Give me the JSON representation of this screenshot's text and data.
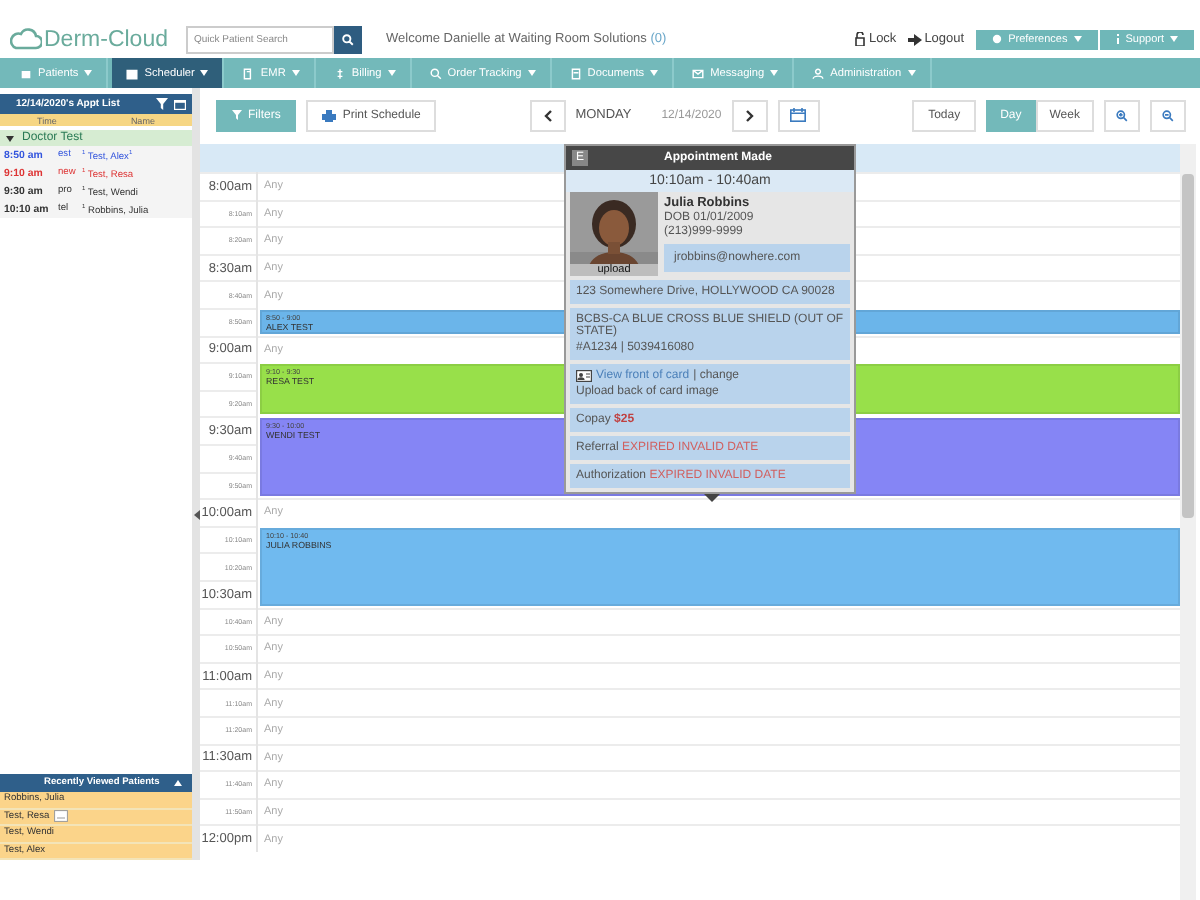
{
  "header": {
    "logo": "Derm-Cloud",
    "search": {
      "placeholder": "Quick Patient Search"
    },
    "welcome": "Welcome Danielle at Waiting Room Solutions",
    "welcome_count": "(0)",
    "lock": "Lock",
    "logout": "Logout",
    "menus": [
      {
        "label": "Preferences"
      },
      {
        "label": "Support"
      }
    ]
  },
  "nav": [
    {
      "label": "Patients",
      "selected": false
    },
    {
      "label": "Scheduler",
      "selected": true
    },
    {
      "label": "EMR",
      "selected": false
    },
    {
      "label": "Billing",
      "selected": false
    },
    {
      "label": "Order Tracking",
      "selected": false
    },
    {
      "label": "Documents",
      "selected": false
    },
    {
      "label": "Messaging",
      "selected": false
    },
    {
      "label": "Administration",
      "selected": false
    }
  ],
  "sidebar": {
    "title": "12/14/2020's Appt List",
    "columns": [
      "Time",
      "Name"
    ],
    "group": {
      "label": "Doctor Test",
      "expanded": true
    },
    "appointments": [
      {
        "time": "8:50 am",
        "type": "est",
        "name": "$^{1}$ Test, Alex$^{1}$",
        "color": "#3355dd"
      },
      {
        "time": "9:10 am",
        "type": "new",
        "name": "$^{1}$ Test, Resa",
        "color": "#dd3333"
      },
      {
        "time": "9:30 am",
        "type": "pro",
        "name": "$^{1}$ Test, Wendi",
        "color": "#333333"
      },
      {
        "time": "10:10 am",
        "type": "tel",
        "name": "$^{1}$ Robbins, Julia",
        "color": "#333333"
      }
    ]
  },
  "recent": {
    "title": "Recently Viewed Patients",
    "items": [
      {
        "name": "Robbins, Julia",
        "note": false
      },
      {
        "name": "Test, Resa",
        "note": true
      },
      {
        "name": "Test, Wendi",
        "note": false
      },
      {
        "name": "Test, Alex",
        "note": false
      }
    ]
  },
  "toolbar": {
    "filters": "Filters",
    "print": "Print Schedule",
    "day_name": "MONDAY",
    "date": "12/14/2020",
    "today": "Today",
    "views": [
      {
        "label": "Day",
        "selected": true
      },
      {
        "label": "Week",
        "selected": false
      }
    ]
  },
  "calendar": {
    "rows": [
      {
        "kind": "open",
        "text": "Any",
        "times": [
          {
            "label": "8:00am",
            "major": true
          }
        ]
      },
      {
        "kind": "open",
        "text": "Any",
        "times": [
          {
            "label": "8:10am",
            "major": false
          }
        ]
      },
      {
        "kind": "open",
        "text": "Any",
        "times": [
          {
            "label": "8:20am",
            "major": false
          }
        ]
      },
      {
        "kind": "open",
        "text": "Any",
        "times": [
          {
            "label": "8:30am",
            "major": true
          }
        ]
      },
      {
        "kind": "open",
        "text": "Any",
        "times": [
          {
            "label": "8:40am",
            "major": false
          }
        ]
      },
      {
        "kind": "appointment",
        "range": "8:50 - 9:00",
        "patient": "ALEX TEST",
        "color": "#6bb5ea",
        "times": [
          {
            "label": "8:50am",
            "major": false
          }
        ]
      },
      {
        "kind": "open",
        "text": "Any",
        "times": [
          {
            "label": "9:00am",
            "major": true
          }
        ]
      },
      {
        "kind": "appointment",
        "range": "9:10 - 9:30",
        "patient": "RESA TEST",
        "color": "#98e04a",
        "times": [
          {
            "label": "9:10am",
            "major": false
          },
          {
            "label": "9:20am",
            "major": false
          }
        ]
      },
      {
        "kind": "appointment",
        "range": "9:30 - 10:00",
        "patient": "WENDI TEST",
        "color": "#8585f5",
        "times": [
          {
            "label": "9:30am",
            "major": true
          },
          {
            "label": "9:40am",
            "major": false
          },
          {
            "label": "9:50am",
            "major": false
          }
        ]
      },
      {
        "kind": "open",
        "text": "Any",
        "times": [
          {
            "label": "10:00am",
            "major": true
          }
        ]
      },
      {
        "kind": "appointment",
        "range": "10:10 - 10:40",
        "patient": "JULIA ROBBINS",
        "color": "#70baef",
        "times": [
          {
            "label": "10:10am",
            "major": false
          },
          {
            "label": "10:20am",
            "major": false
          },
          {
            "label": "10:30am",
            "major": true
          }
        ]
      },
      {
        "kind": "open",
        "text": "Any",
        "times": [
          {
            "label": "10:40am",
            "major": false
          }
        ]
      },
      {
        "kind": "open",
        "text": "Any",
        "times": [
          {
            "label": "10:50am",
            "major": false
          }
        ]
      },
      {
        "kind": "open",
        "text": "Any",
        "times": [
          {
            "label": "11:00am",
            "major": true
          }
        ]
      },
      {
        "kind": "open",
        "text": "Any",
        "times": [
          {
            "label": "11:10am",
            "major": false
          }
        ]
      },
      {
        "kind": "open",
        "text": "Any",
        "times": [
          {
            "label": "11:20am",
            "major": false
          }
        ]
      },
      {
        "kind": "open",
        "text": "Any",
        "times": [
          {
            "label": "11:30am",
            "major": true
          }
        ]
      },
      {
        "kind": "open",
        "text": "Any",
        "times": [
          {
            "label": "11:40am",
            "major": false
          }
        ]
      },
      {
        "kind": "open",
        "text": "Any",
        "times": [
          {
            "label": "11:50am",
            "major": false
          }
        ]
      },
      {
        "kind": "open",
        "text": "Any",
        "times": [
          {
            "label": "12:00pm",
            "major": true
          }
        ]
      }
    ]
  },
  "popup": {
    "badge": "E",
    "status": "Appointment Made",
    "time": "10:10am - 10:40am",
    "photo_label": "upload",
    "name": "Julia Robbins",
    "dob": "DOB 01/01/2009",
    "phone": "(213)999-9999",
    "email": "jrobbins@nowhere.com",
    "address": "123 Somewhere Drive, HOLLYWOOD CA 90028",
    "insurance": "BCBS-CA BLUE CROSS BLUE SHIELD (OUT OF STATE)",
    "policy": "#A1234 | 5039416080",
    "card_link": "View front of card",
    "card_change": "| change",
    "card_back": "Upload back of card image",
    "fields": [
      {
        "label": "Copay",
        "value": "$25"
      },
      {
        "label": "Referral",
        "value": "EXPIRED INVALID DATE"
      },
      {
        "label": "Authorization",
        "value": "EXPIRED INVALID DATE"
      }
    ]
  }
}
